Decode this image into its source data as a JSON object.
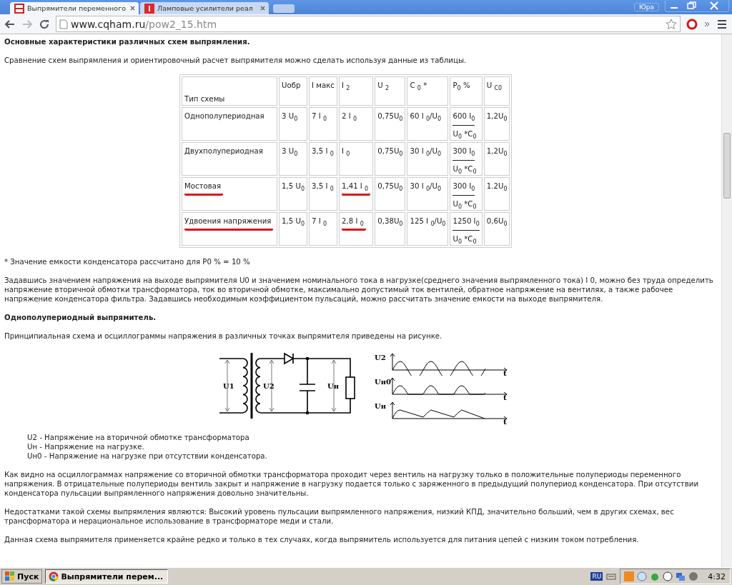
{
  "window": {
    "tabs": [
      {
        "title": "Выпрямители переменного",
        "selected": true,
        "kind": "site"
      },
      {
        "title": "Ламповые усилители реал",
        "selected": false,
        "kind": "tube"
      }
    ],
    "user": "Юра"
  },
  "toolbar": {
    "address_host": "www.cqham.ru",
    "address_path": "/pow2_15.htm"
  },
  "content": [
    {
      "kind": "heading",
      "text": "Основные характеристики различных схем выпрямления."
    },
    {
      "kind": "paragraph",
      "text": "Сравнение схем выпрямления и ориентировочный расчет выпрямителя можно сделать используя данные из таблицы."
    },
    {
      "kind": "table",
      "columns": [
        "Тип схемы",
        "Uобр",
        "I макс",
        "I $_{2}$",
        "U $_{2}$",
        "C $_{0}$ *",
        "P$_{0}$ %",
        "U $_{C0}$"
      ],
      "rows": [
        {
          "cells": [
            {
              "text": "Однополупериодная",
              "marked": false
            },
            {
              "text": "3 U$_{0}$",
              "marked": false
            },
            {
              "text": "7 I $_{0}$",
              "marked": false
            },
            {
              "text": "2 I $_{0}$",
              "marked": false
            },
            {
              "text": "0,75U$_{0}$",
              "marked": false
            },
            {
              "text": "60 I $_{0}$/U$_{0}$",
              "marked": false
            },
            {
              "kind": "fraction",
              "num": "600 I$_{0}$",
              "den": "U$_{0}$ *C$_{0}$",
              "marked": false
            },
            {
              "text": "1,2U$_{0}$",
              "marked": false
            }
          ]
        },
        {
          "cells": [
            {
              "text": "Двухполупериодная",
              "marked": false
            },
            {
              "text": "3 U$_{0}$",
              "marked": false
            },
            {
              "text": "3,5 I $_{0}$",
              "marked": false
            },
            {
              "text": "I $_{0}$",
              "marked": false
            },
            {
              "text": "0,75U$_{0}$",
              "marked": false
            },
            {
              "text": "30 I $_{0}$/U$_{0}$",
              "marked": false
            },
            {
              "kind": "fraction",
              "num": "300 I$_{0}$",
              "den": "U$_{0}$ *C$_{0}$",
              "marked": false
            },
            {
              "text": "1,2U$_{0}$",
              "marked": false
            }
          ]
        },
        {
          "cells": [
            {
              "text": "Мостовая",
              "marked": true
            },
            {
              "text": "1,5 U$_{0}$",
              "marked": false
            },
            {
              "text": "3,5 I $_{0}$",
              "marked": false
            },
            {
              "text": "1,41 I $_{0}$",
              "marked": true
            },
            {
              "text": "0,75U$_{0}$",
              "marked": false
            },
            {
              "text": "30 I $_{0}$/U$_{0}$",
              "marked": false
            },
            {
              "kind": "fraction",
              "num": "300 I$_{0}$",
              "den": "U$_{0}$ *C$_{0}$",
              "marked": false
            },
            {
              "text": "1.2U$_{0}$",
              "marked": false
            }
          ]
        },
        {
          "cells": [
            {
              "text": "Удвоения напряжения",
              "marked": true
            },
            {
              "text": "1,5 U$_{0}$",
              "marked": false
            },
            {
              "text": "7 I $_{0}$",
              "marked": false
            },
            {
              "text": "2,8 I $_{0}$",
              "marked": true
            },
            {
              "text": "0,38U$_{0}$",
              "marked": false
            },
            {
              "text": "125 I $_{0}$/U$_{0}$",
              "marked": false
            },
            {
              "kind": "fraction",
              "num": "1250 I$_{0}$",
              "den": "U$_{0}$ *C$_{0}$",
              "marked": false
            },
            {
              "text": "0,6U$_{0}$",
              "marked": false
            }
          ]
        }
      ]
    },
    {
      "kind": "paragraph",
      "text": "* Значение емкости конденсатора рассчитано для P0 % = 10 %"
    },
    {
      "kind": "paragraph",
      "text": "Задавшись значением напряжения на выходе выпрямителя U0 и значением номинального тока в нагрузке(среднего значения выпрямленного тока) I 0, можно без труда определить напряжение вторичной обмотки трансформатора, ток во вторичной обмотке, максимально допустимый ток вентилей, обратное напряжение на вентилях, а также рабочее напряжение конденсатора фильтра. Задавшись необходимым коэффициентом пульсаций, можно рассчитать значение емкости на выходе выпрямителя."
    },
    {
      "kind": "heading",
      "text": "Однополупериодный выпрямитель."
    },
    {
      "kind": "paragraph",
      "text": "Принципиальная схема и осциллограммы напряжения в различных точках выпрямителя приведены на рисунке."
    },
    {
      "kind": "figure",
      "circuit_labels": [
        "U1",
        "U2",
        "Uн"
      ],
      "plots": [
        {
          "label": "U2",
          "axis": "t",
          "kind": "sine"
        },
        {
          "label": "Uн0",
          "axis": "t",
          "kind": "half"
        },
        {
          "label": "Uн",
          "axis": "t",
          "kind": "ripple"
        }
      ]
    },
    {
      "kind": "list",
      "items": [
        "U2 - Напряжение на вторичной обмотке трансформатора",
        "Uн - Напряжение на нагрузке.",
        "Uн0 - Напряжение на нагрузке при отсутствии конденсатора."
      ]
    },
    {
      "kind": "paragraph",
      "text": "Как видно на осциллограммах напряжение со вторичной обмотки трансформатора проходит через вентиль на нагрузку только в положительные полупериоды переменного напряжения. В отрицательные полупериоды вентиль закрыт и напряжение в нагрузку подается только с заряженного в предыдущий полупериод конденсатора. При отсутствии конденсатора пульсации выпрямленного напряжения довольно значительны."
    },
    {
      "kind": "paragraph",
      "text": "Недостатками такой схемы выпрямления являются: Высокий уровень пульсации выпрямленного напряжения, низкий КПД, значительно больший, чем в других схемах, вес трансформатора и нерациональное использование в трансформаторе меди и стали."
    },
    {
      "kind": "paragraph",
      "text": "Данная схема выпрямителя применяется крайне редко и только в тех случаях, когда выпрямитель используется для питания цепей с низким током потребления."
    }
  ],
  "taskbar": {
    "start": "Пуск",
    "tasks": [
      {
        "title": "Выпрямители перем...",
        "selected": true
      }
    ],
    "language": "RU",
    "time": "4:32"
  }
}
